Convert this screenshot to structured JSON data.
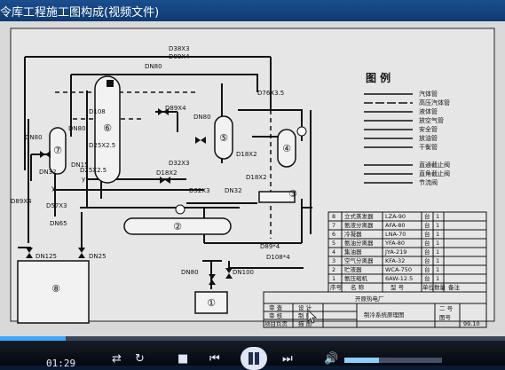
{
  "window": {
    "title": "令库工程施工图构成(视频文件)"
  },
  "drawing": {
    "legend": {
      "title": "图 例",
      "items": [
        "汽体管",
        "高压汽体管",
        "液体管",
        "放空气管",
        "安全管",
        "放油管",
        "干衡管",
        "直通截止阀",
        "直角截止阀",
        "节流阀"
      ]
    },
    "pipe_labels": {
      "d38x3": "D38X3",
      "d89x4_top": "D89X4",
      "d76": "D76X3.5",
      "dn80_a": "DN80",
      "dn80_b": "DN80",
      "dn80_c": "DN80",
      "dn80_d": "DN80",
      "dn80_e": "DN80",
      "d89x4_mid": "D89X4",
      "d18x2_a": "D18X2",
      "d18x2_b": "D18X2",
      "d18x2_c": "D18X2",
      "d32x3_a": "D32X3",
      "d32x3_b": "D32X3",
      "dn32_a": "DN32",
      "dn32_b": "DN32",
      "dn15": "DN15",
      "dn125": "DN125",
      "dn25": "DN25",
      "dn100": "DN100",
      "d89x4_left": "D89X4",
      "d89x4_bot": "D89*4",
      "d108x4": "D108*4",
      "v108": "D108",
      "v25": "D25X2.5",
      "v25b": "D25X2.5",
      "v57": "D57X3",
      "dn65": "DN65",
      "y1": "y",
      "y2": "y"
    },
    "equipment_numbers": [
      "①",
      "②",
      "③",
      "④",
      "⑤",
      "⑥",
      "⑦",
      "⑧"
    ],
    "equipment_table": {
      "rows": [
        {
          "no": "8",
          "name": "立式蒸发器",
          "model": "LZA-90",
          "unit": "台",
          "qty": "1"
        },
        {
          "no": "7",
          "name": "氨液分离器",
          "model": "AFA-80",
          "unit": "台",
          "qty": "1"
        },
        {
          "no": "6",
          "name": "冷凝器",
          "model": "LNA-70",
          "unit": "台",
          "qty": "1"
        },
        {
          "no": "5",
          "name": "氨油分离器",
          "model": "YFA-80",
          "unit": "台",
          "qty": "1"
        },
        {
          "no": "4",
          "name": "集油器",
          "model": "JYA-219",
          "unit": "台",
          "qty": "1"
        },
        {
          "no": "3",
          "name": "空气分离器",
          "model": "KFA-32",
          "unit": "台",
          "qty": "1"
        },
        {
          "no": "2",
          "name": "贮液器",
          "model": "WCA-750",
          "unit": "台",
          "qty": "1"
        },
        {
          "no": "1",
          "name": "氨压缩机",
          "model": "6AW-12.5",
          "unit": "台",
          "qty": "1"
        }
      ],
      "header": [
        "序号",
        "名 称",
        "型 号",
        "单位",
        "数量",
        "备注"
      ]
    },
    "title_block": {
      "company": "开原热电厂",
      "drawing_name": "制冷系统原理图",
      "role1": "审 查",
      "role2": "审 核",
      "role3": "项目负责",
      "role4": "设 计",
      "role5": "制 图",
      "role6": "描 图",
      "field1": "二 号",
      "field2": "图号",
      "date": "99.10"
    }
  },
  "player": {
    "time": "01:29",
    "progress": 0.13,
    "volume": 0.35
  }
}
